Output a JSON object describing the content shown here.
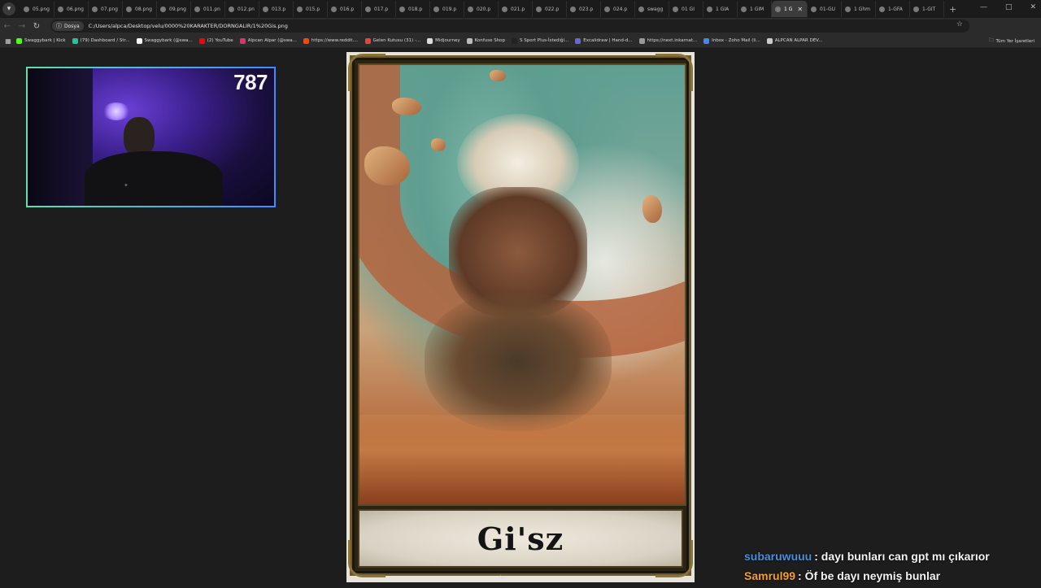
{
  "browser": {
    "tabs": [
      {
        "label": "05.png"
      },
      {
        "label": "06.png"
      },
      {
        "label": "07.png"
      },
      {
        "label": "08.png"
      },
      {
        "label": "09.png"
      },
      {
        "label": "011.pn"
      },
      {
        "label": "012.pn"
      },
      {
        "label": "013.p"
      },
      {
        "label": "015.p"
      },
      {
        "label": "016.p"
      },
      {
        "label": "017.p"
      },
      {
        "label": "018.p"
      },
      {
        "label": "019.p"
      },
      {
        "label": "020.p"
      },
      {
        "label": "021.p"
      },
      {
        "label": "022.p"
      },
      {
        "label": "023.p"
      },
      {
        "label": "024.p"
      },
      {
        "label": "swagg"
      },
      {
        "label": "01 GI"
      },
      {
        "label": "1 GIA"
      },
      {
        "label": "1 GIM"
      },
      {
        "label": "1 G",
        "active": true
      },
      {
        "label": "01-GU"
      },
      {
        "label": "1 Ghm"
      },
      {
        "label": "1-GFA"
      },
      {
        "label": "1-GIT"
      }
    ],
    "address": {
      "scheme_label": "Dosya",
      "url": "C:/Users/alpca/Desktop/velu/0000%20KARAKTER/DORNGALIR/1%20Gis.png"
    },
    "bookmarks": [
      {
        "label": "Swaggybark | Kick",
        "color": "#53fc18"
      },
      {
        "label": "(79) Dashboard / Str...",
        "color": "#20c5a0"
      },
      {
        "label": "Swaggybark (@swa...",
        "color": "#ffffff"
      },
      {
        "label": "(2) YouTube",
        "color": "#ff0000"
      },
      {
        "label": "Alpcan Alpar (@swa...",
        "color": "#e1306c"
      },
      {
        "label": "https://www.reddit....",
        "color": "#ff4500"
      },
      {
        "label": "Gelen Kutusu (31) -...",
        "color": "#ea4335"
      },
      {
        "label": "Midjourney",
        "color": "#dddddd"
      },
      {
        "label": "Konfuse Shop",
        "color": "#bbbbbb"
      },
      {
        "label": "S Sport Plus-İstediği...",
        "color": "#222222"
      },
      {
        "label": "Excalidraw | Hand-d...",
        "color": "#6965db"
      },
      {
        "label": "https://next.inkarnat...",
        "color": "#999999"
      },
      {
        "label": "Inbox - Zoho Mail (li...",
        "color": "#4285f4"
      },
      {
        "label": "ALPCAN ALPAR DEV...",
        "color": "#cccccc"
      }
    ],
    "all_bookmarks_label": "Tüm Yer İşaretleri"
  },
  "webcam": {
    "counter": "787",
    "border_colors": [
      "#5fe0a8",
      "#3f8cff"
    ]
  },
  "card": {
    "name": "Gi'sz"
  },
  "chat": {
    "messages": [
      {
        "user": "subaruwuuu",
        "user_color": "#4b8fd8",
        "text": ": dayı bunları can gpt mı çıkarıor"
      },
      {
        "user": "Samrul99",
        "user_color": "#f0a030",
        "text": ": Öf be dayı neymiş bunlar"
      }
    ]
  }
}
